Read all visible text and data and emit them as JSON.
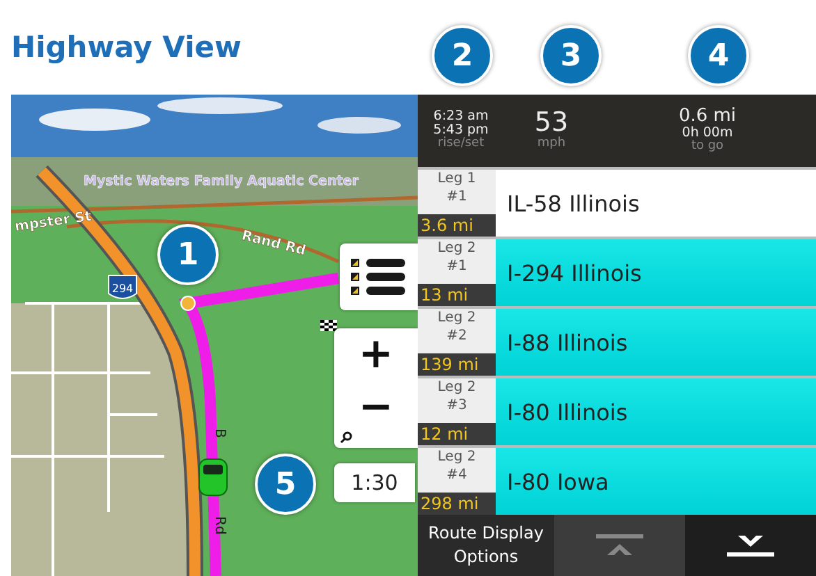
{
  "title": "Highway View",
  "callouts": [
    {
      "number": "1"
    },
    {
      "number": "2"
    },
    {
      "number": "3"
    },
    {
      "number": "4"
    },
    {
      "number": "5"
    }
  ],
  "map": {
    "labels": [
      "Mystic Waters Family Aquatic Center",
      "mpster St",
      "Rand Rd"
    ],
    "shield": "294",
    "route_road": [
      "B",
      "Rd"
    ]
  },
  "zoom": {
    "in": "+",
    "out": "−",
    "scale": "1:30"
  },
  "trip": {
    "rise": "6:23 am",
    "set": "5:43 pm",
    "rise_set_label": "rise/set",
    "speed": "53",
    "speed_unit": "mph",
    "distance": "0.6 mi",
    "time": "0h 00m",
    "to_go_label": "to go"
  },
  "legs": [
    {
      "leg": "Leg 1",
      "step": "#1",
      "distance": "3.6 mi",
      "road": "IL-58 Illinois",
      "highlighted": false
    },
    {
      "leg": "Leg 2",
      "step": "#1",
      "distance": "13 mi",
      "road": "I-294 Illinois",
      "highlighted": true
    },
    {
      "leg": "Leg 2",
      "step": "#2",
      "distance": "139 mi",
      "road": "I-88 Illinois",
      "highlighted": true
    },
    {
      "leg": "Leg 2",
      "step": "#3",
      "distance": "12 mi",
      "road": "I-80 Illinois",
      "highlighted": true
    },
    {
      "leg": "Leg 2",
      "step": "#4",
      "distance": "298 mi",
      "road": "I-80 Iowa",
      "highlighted": true
    }
  ],
  "footer": {
    "options_label": "Route Display Options",
    "scroll_up_disabled": true,
    "scroll_down_disabled": false
  }
}
